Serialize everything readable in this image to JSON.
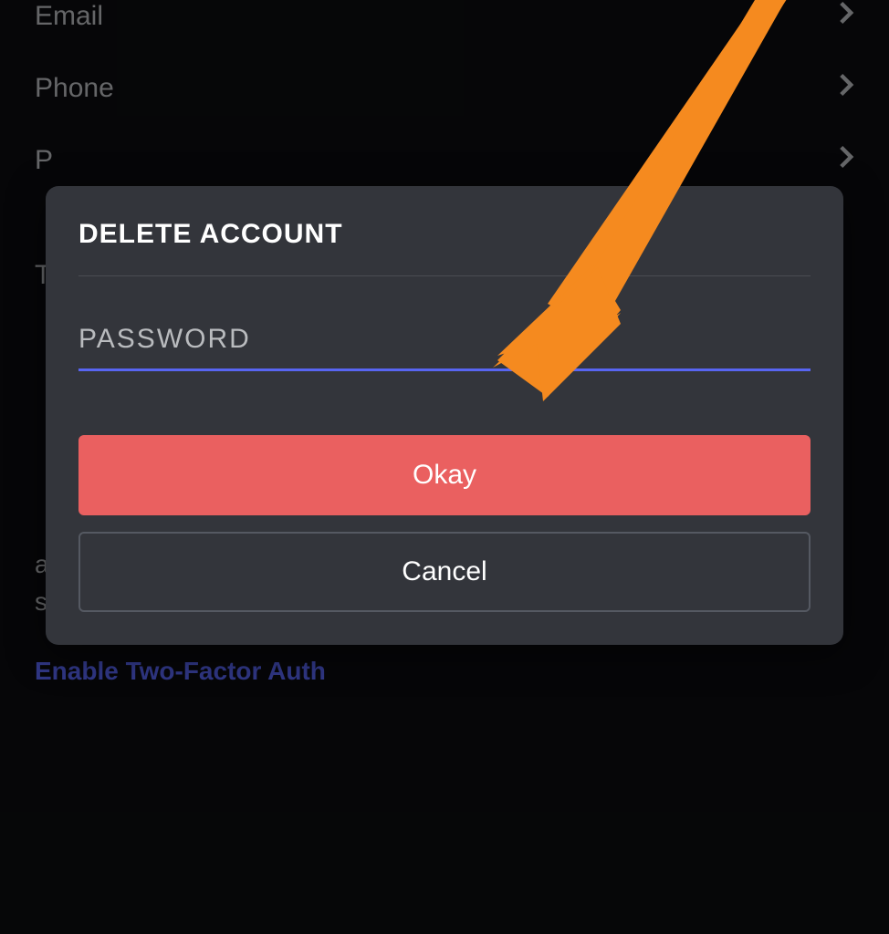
{
  "settings": {
    "email": {
      "label": "Email"
    },
    "phone": {
      "label": "Phone"
    },
    "password_row": {
      "label": "P"
    },
    "t_section": {
      "label": "T"
    }
  },
  "help_text_fragment_1": "a",
  "help_text_line2": "sign in.",
  "two_factor_link": "Enable Two-Factor Auth",
  "modal": {
    "title": "DELETE ACCOUNT",
    "password_placeholder": "PASSWORD",
    "okay_label": "Okay",
    "cancel_label": "Cancel"
  }
}
